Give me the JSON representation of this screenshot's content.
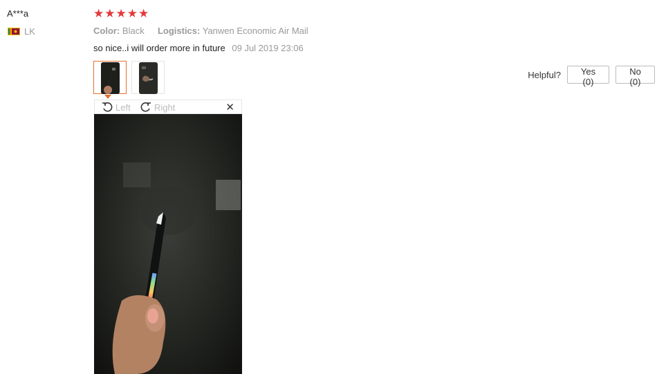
{
  "reviewer": {
    "name": "A***a",
    "country": "LK"
  },
  "rating": {
    "stars": 5,
    "max": 5
  },
  "attributes": {
    "color_label": "Color:",
    "color_value": "Black",
    "logistics_label": "Logistics:",
    "logistics_value": "Yanwen Economic Air Mail"
  },
  "review": {
    "text": "so nice..i will order more in future",
    "date": "09 Jul 2019 23:06"
  },
  "helpful": {
    "label": "Helpful?",
    "yes": "Yes (0)",
    "no": "No (0)"
  },
  "viewer": {
    "rotate_left": "Left",
    "rotate_right": "Right",
    "close_icon": "close-icon"
  },
  "colors": {
    "star": "#e4393c",
    "active_thumb": "#e4702d"
  }
}
